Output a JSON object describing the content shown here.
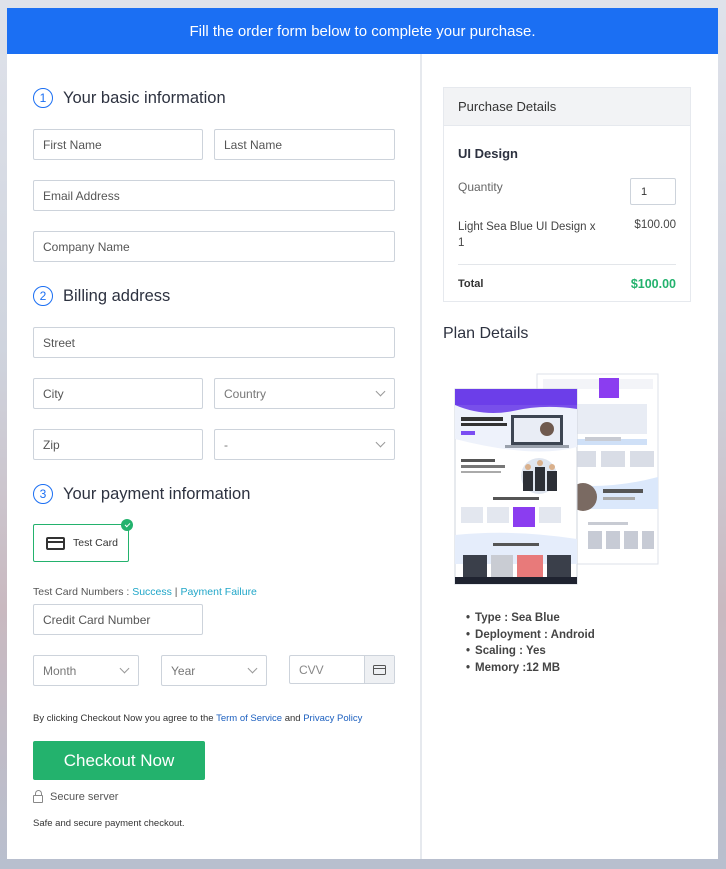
{
  "banner": "Fill the order form below to complete your purchase.",
  "sections": {
    "basic": {
      "num": "1",
      "title": "Your basic information"
    },
    "billing": {
      "num": "2",
      "title": "Billing address"
    },
    "payment": {
      "num": "3",
      "title": "Your payment information"
    }
  },
  "fields": {
    "first_name": "First Name",
    "last_name": "Last Name",
    "email": "Email Address",
    "company": "Company Name",
    "street": "Street",
    "city": "City",
    "country": "Country",
    "zip": "Zip",
    "state": "-",
    "card_number": "Credit Card Number",
    "month": "Month",
    "year": "Year",
    "cvv": "CVV"
  },
  "payment": {
    "test_card": "Test Card",
    "test_numbers_label": "Test Card Numbers : ",
    "success": "Success",
    "separator": " | ",
    "failure": "Payment Failure"
  },
  "agreement": {
    "prefix": "By clicking Checkout Now you agree to the ",
    "terms": "Term of Service",
    "and": " and ",
    "privacy": "Privacy Policy"
  },
  "checkout_label": "Checkout Now",
  "secure_label": "Secure server",
  "safe_label": "Safe and secure payment checkout.",
  "purchase": {
    "heading": "Purchase Details",
    "product": "UI Design",
    "quantity_label": "Quantity",
    "quantity": "1",
    "item_name": "Light Sea Blue UI Design x 1",
    "item_price": "$100.00",
    "total_label": "Total",
    "total_value": "$100.00"
  },
  "plan": {
    "title": "Plan Details",
    "features": [
      "Type : Sea Blue",
      "Deployment : Android",
      "Scaling : Yes",
      "Memory :12 MB"
    ]
  },
  "colors": {
    "primary": "#1b6ff3",
    "accent": "#23b26d",
    "link": "#20a6c8"
  }
}
